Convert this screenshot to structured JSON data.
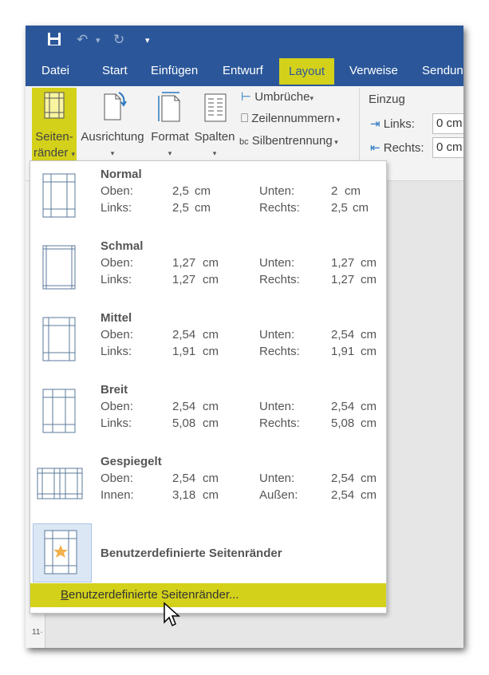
{
  "tabs": [
    "Datei",
    "Start",
    "Einfügen",
    "Entwurf",
    "Layout",
    "Verweise",
    "Sendun"
  ],
  "ribbon": {
    "seiten_line1": "Seiten-",
    "seiten_line2": "ränder",
    "ausrichtung": "Ausrichtung",
    "format": "Format",
    "spalten": "Spalten",
    "umbrueche": "Umbrüche",
    "zeilennummern": "Zeilennummern",
    "silbentrennung": "Silbentrennung",
    "einzug": "Einzug",
    "links_label": "Links:",
    "links_value": "0 cm",
    "rechts_label": "Rechts:",
    "rechts_value": "0 cm"
  },
  "margins": [
    {
      "name": "Normal",
      "r1": [
        "Oben:",
        "2,5",
        "cm",
        "Unten:",
        "2",
        "cm"
      ],
      "r2": [
        "Links:",
        "2,5",
        "cm",
        "Rechts:",
        "2,5",
        "cm"
      ]
    },
    {
      "name": "Schmal",
      "r1": [
        "Oben:",
        "1,27",
        "cm",
        "Unten:",
        "1,27",
        "cm"
      ],
      "r2": [
        "Links:",
        "1,27",
        "cm",
        "Rechts:",
        "1,27",
        "cm"
      ]
    },
    {
      "name": "Mittel",
      "r1": [
        "Oben:",
        "2,54",
        "cm",
        "Unten:",
        "2,54",
        "cm"
      ],
      "r2": [
        "Links:",
        "1,91",
        "cm",
        "Rechts:",
        "1,91",
        "cm"
      ]
    },
    {
      "name": "Breit",
      "r1": [
        "Oben:",
        "2,54",
        "cm",
        "Unten:",
        "2,54",
        "cm"
      ],
      "r2": [
        "Links:",
        "5,08",
        "cm",
        "Rechts:",
        "5,08",
        "cm"
      ]
    },
    {
      "name": "Gespiegelt",
      "r1": [
        "Oben:",
        "2,54",
        "cm",
        "Unten:",
        "2,54",
        "cm"
      ],
      "r2": [
        "Innen:",
        "3,18",
        "cm",
        "Außen:",
        "2,54",
        "cm"
      ]
    }
  ],
  "custom": {
    "name": "Benutzerdefinierte Seitenränder",
    "command": "Benutzerdefinierte Seitenränder..."
  },
  "colors": {
    "ribbon_blue": "#2b579a",
    "highlight": "#d4d11a"
  }
}
